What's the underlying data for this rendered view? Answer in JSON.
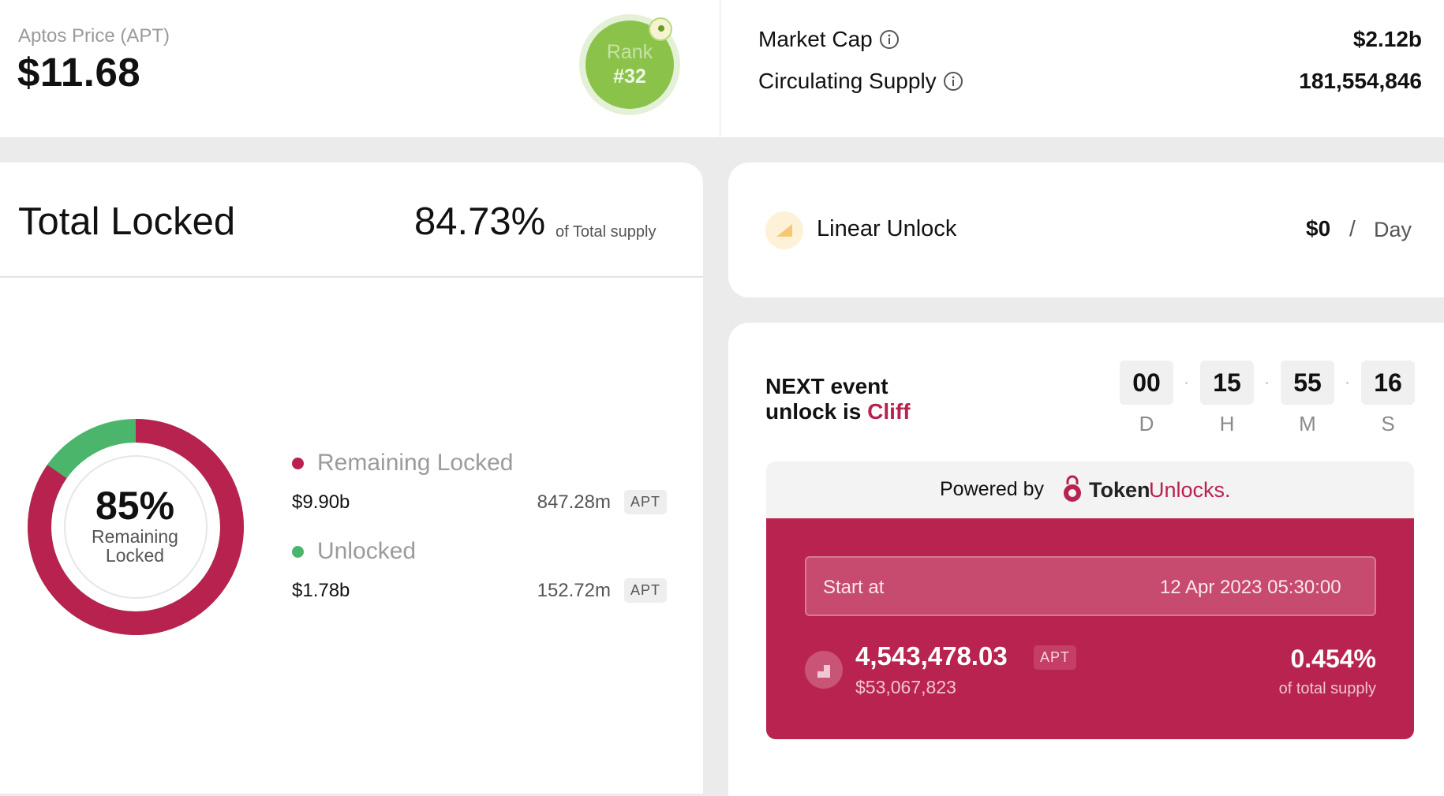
{
  "header": {
    "price_label": "Aptos Price (APT)",
    "price_value": "$11.68",
    "rank_label": "Rank",
    "rank_value": "#32",
    "market_cap_label": "Market Cap",
    "market_cap_value": "$2.12b",
    "circulating_label": "Circulating Supply",
    "circulating_value": "181,554,846"
  },
  "locked": {
    "title": "Total Locked",
    "percent": "84.73%",
    "percent_sub": "of Total supply",
    "donut_percent": "85%",
    "donut_label_1": "Remaining",
    "donut_label_2": "Locked",
    "donut_fraction_locked": 0.8473,
    "remaining": {
      "label": "Remaining Locked",
      "usd": "$9.90b",
      "amount": "847.28m",
      "tag": "APT",
      "color": "#b8224f"
    },
    "unlocked": {
      "label": "Unlocked",
      "usd": "$1.78b",
      "amount": "152.72m",
      "tag": "APT",
      "color": "#4cb56c"
    }
  },
  "linear": {
    "label": "Linear Unlock",
    "value": "$0",
    "slash": "/",
    "unit": "Day"
  },
  "next_event": {
    "title_line1": "NEXT event",
    "title_line2_prefix": "unlock is",
    "title_type": "Cliff",
    "countdown": [
      {
        "value": "00",
        "label": "D"
      },
      {
        "value": "15",
        "label": "H"
      },
      {
        "value": "55",
        "label": "M"
      },
      {
        "value": "16",
        "label": "S"
      }
    ],
    "powered_by": "Powered by",
    "brand_token": "Token",
    "brand_unlocks": "Unlocks.",
    "start_label": "Start at",
    "start_date": "12 Apr 2023 05:30:00",
    "amount": "4,543,478.03",
    "amount_tag": "APT",
    "amount_usd": "$53,067,823",
    "pct": "0.454%",
    "pct_sub": "of total supply"
  },
  "colors": {
    "brand": "#b8224f",
    "rank_green": "#8bc34a",
    "unlocked_green": "#4cb56c"
  }
}
